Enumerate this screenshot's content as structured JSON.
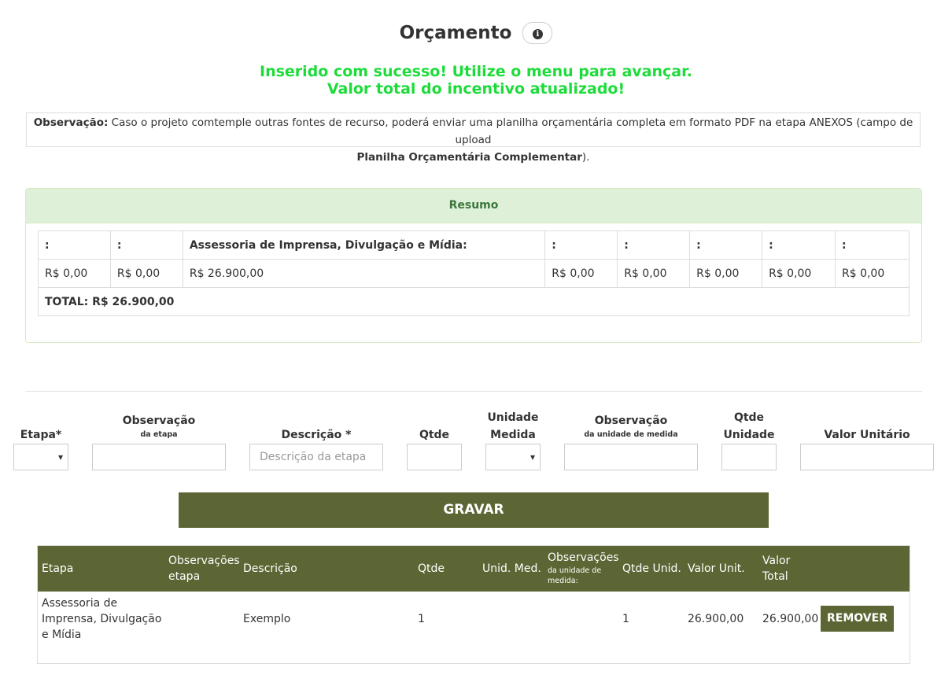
{
  "header": {
    "title": "Orçamento",
    "info_glyph": "i",
    "info_icon": "info-circle-icon"
  },
  "alert": {
    "line1": "Inserido com sucesso! Utilize o menu para avançar.",
    "line2": "Valor total do incentivo atualizado!",
    "color": "#1ddc3a"
  },
  "observacao": {
    "label": "Observação:",
    "text": " Caso o projeto comtemple outras fontes de recurso, poderá enviar uma planilha orçamentária completa em formato PDF na etapa ANEXOS (campo de upload",
    "emphasis": "Planilha Orçamentária Complementar",
    "closing": ")."
  },
  "resumo": {
    "heading": "Resumo",
    "headers": [
      ":",
      ":",
      "Assessoria de Imprensa, Divulgação e Mídia:",
      ":",
      ":",
      ":",
      ":",
      ":"
    ],
    "values": [
      "R$ 0,00",
      "R$ 0,00",
      "R$ 26.900,00",
      "R$ 0,00",
      "R$ 0,00",
      "R$ 0,00",
      "R$ 0,00",
      "R$ 0,00"
    ],
    "total": "TOTAL: R$ 26.900,00"
  },
  "form": {
    "etapa_label": "Etapa*",
    "obs_etapa_label": "Observação",
    "obs_etapa_sub": "da etapa",
    "descricao_label": "Descrição *",
    "descricao_placeholder": "Descrição da etapa",
    "qtde_label": "Qtde",
    "unidade_label_1": "Unidade",
    "unidade_label_2": "Medida",
    "obs_unidade_label": "Observação",
    "obs_unidade_sub": "da unidade de medida",
    "qtde_unidade_label_1": "Qtde",
    "qtde_unidade_label_2": "Unidade",
    "valor_unitario_label": "Valor Unitário",
    "submit_label": "GRAVAR"
  },
  "list": {
    "columns": {
      "etapa": "Etapa",
      "obs_etapa_1": "Observações",
      "obs_etapa_2": "etapa",
      "descricao": "Descrição",
      "qtde": "Qtde",
      "unid_med": "Unid. Med.",
      "obs_unidade": "Observações",
      "obs_unidade_sub": "da unidade de medida:",
      "qtde_unid": "Qtde Unid.",
      "valor_unit": "Valor Unit.",
      "valor_total_1": "Valor",
      "valor_total_2": "Total"
    },
    "rows": [
      {
        "etapa_1": "Assessoria de",
        "etapa_2": "Imprensa, Divulgação",
        "etapa_3": "e Mídia",
        "descricao": "Exemplo",
        "qtde": "1",
        "qtde_unid": "1",
        "valor_unit": "26.900,00",
        "valor_total": "26.900,00",
        "action": "REMOVER"
      }
    ]
  },
  "colors": {
    "brand": "#5c6634",
    "panel_heading_bg": "#dff0d8",
    "panel_heading_text": "#3c763d"
  }
}
